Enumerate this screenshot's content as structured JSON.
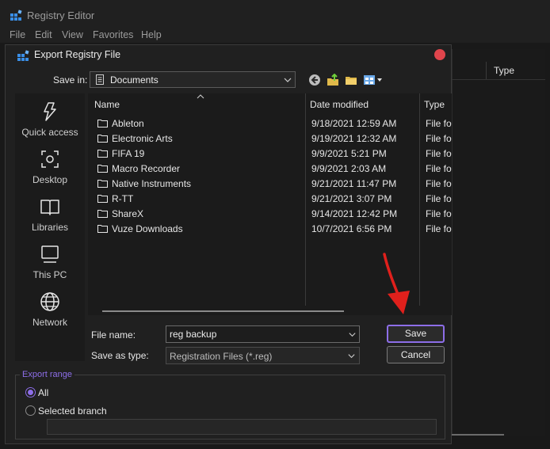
{
  "registry": {
    "title": "Registry Editor",
    "menu": [
      {
        "key": "F",
        "rest": "ile"
      },
      {
        "key": "E",
        "rest": "dit"
      },
      {
        "key": "V",
        "rest": "iew"
      },
      {
        "key": "F",
        "rest": "avorites",
        "pre": "Fav",
        "keyMid": "o",
        "post": "rites"
      },
      {
        "key": "H",
        "rest": "elp"
      }
    ],
    "menu_labels": [
      "File",
      "Edit",
      "View",
      "Favorites",
      "Help"
    ],
    "type_header": "Type"
  },
  "dialog": {
    "title": "Export Registry File",
    "save_in_label": "Save in:",
    "save_in_value": "Documents",
    "places": [
      {
        "label": "Quick access",
        "icon": "pin-icon"
      },
      {
        "label": "Desktop",
        "icon": "desktop-icon"
      },
      {
        "label": "Libraries",
        "icon": "libraries-icon"
      },
      {
        "label": "This PC",
        "icon": "computer-icon"
      },
      {
        "label": "Network",
        "icon": "network-icon"
      }
    ],
    "columns": {
      "name": "Name",
      "date": "Date modified",
      "type": "Type"
    },
    "files": [
      {
        "name": "Ableton",
        "date": "9/18/2021 12:59 AM",
        "type": "File fo"
      },
      {
        "name": "Electronic Arts",
        "date": "9/19/2021 12:32 AM",
        "type": "File fo"
      },
      {
        "name": "FIFA 19",
        "date": "9/9/2021 5:21 PM",
        "type": "File fo"
      },
      {
        "name": "Macro Recorder",
        "date": "9/9/2021 2:03 AM",
        "type": "File fo"
      },
      {
        "name": "Native Instruments",
        "date": "9/21/2021 11:47 PM",
        "type": "File fo"
      },
      {
        "name": "R-TT",
        "date": "9/21/2021 3:07 PM",
        "type": "File fo"
      },
      {
        "name": "ShareX",
        "date": "9/14/2021 12:42 PM",
        "type": "File fo"
      },
      {
        "name": "Vuze Downloads",
        "date": "10/7/2021 6:56 PM",
        "type": "File fo"
      }
    ],
    "file_name_label": "File name:",
    "file_name_value": "reg backup",
    "save_as_type_label": "Save as type:",
    "save_as_type_value": "Registration Files (*.reg)",
    "save_label": "Save",
    "cancel_label": "Cancel",
    "export_range": {
      "legend": "Export range",
      "all_label": "All",
      "selected_branch_label": "Selected branch",
      "selected": "All"
    }
  },
  "colors": {
    "accent": "#8d6ee8",
    "close": "#e0454c",
    "arrow": "#e0201c"
  }
}
